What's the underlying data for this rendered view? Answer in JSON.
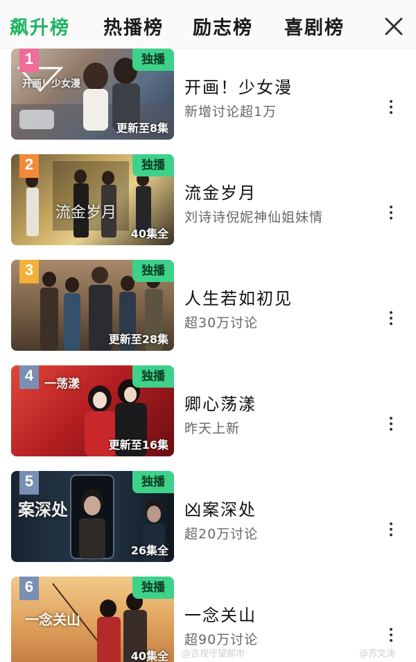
{
  "tabs": [
    {
      "label": "飙升榜",
      "active": true
    },
    {
      "label": "热播榜",
      "active": false
    },
    {
      "label": "励志榜",
      "active": false
    },
    {
      "label": "喜剧榜",
      "active": false
    }
  ],
  "close_icon": "close-icon",
  "colors": {
    "accent": "#1fb464",
    "exclusive_badge": "#3ed18a"
  },
  "items": [
    {
      "rank": "1",
      "badge": "独播",
      "episodes": "更新至8集",
      "title": "开画！少女漫",
      "subtitle": "新增讨论超1万",
      "poster_text": "开画！少女漫",
      "rank_color": "#f06d9a"
    },
    {
      "rank": "2",
      "badge": "独播",
      "episodes": "40集全",
      "title": "流金岁月",
      "subtitle": "刘诗诗倪妮神仙姐妹情",
      "poster_text": "流金岁月",
      "rank_color": "#f28a3a"
    },
    {
      "rank": "3",
      "badge": "独播",
      "episodes": "更新至28集",
      "title": "人生若如初见",
      "subtitle": "超30万讨论",
      "poster_text": "",
      "rank_color": "#f2b138"
    },
    {
      "rank": "4",
      "badge": "独播",
      "episodes": "更新至16集",
      "title": "卿心荡漾",
      "subtitle": "昨天上新",
      "poster_text": "一荡漾",
      "rank_color": "#7a8fb3"
    },
    {
      "rank": "5",
      "badge": "独播",
      "episodes": "26集全",
      "title": "凶案深处",
      "subtitle": "超20万讨论",
      "poster_text": "案深处",
      "rank_color": "#7a8fb3"
    },
    {
      "rank": "6",
      "badge": "独播",
      "episodes": "40集全",
      "title": "一念关山",
      "subtitle": "超90万讨论",
      "poster_text": "一念关山",
      "rank_color": "#7a8fb3"
    }
  ],
  "watermarks": [
    "@吉视守望都市",
    "@苏文涛"
  ]
}
